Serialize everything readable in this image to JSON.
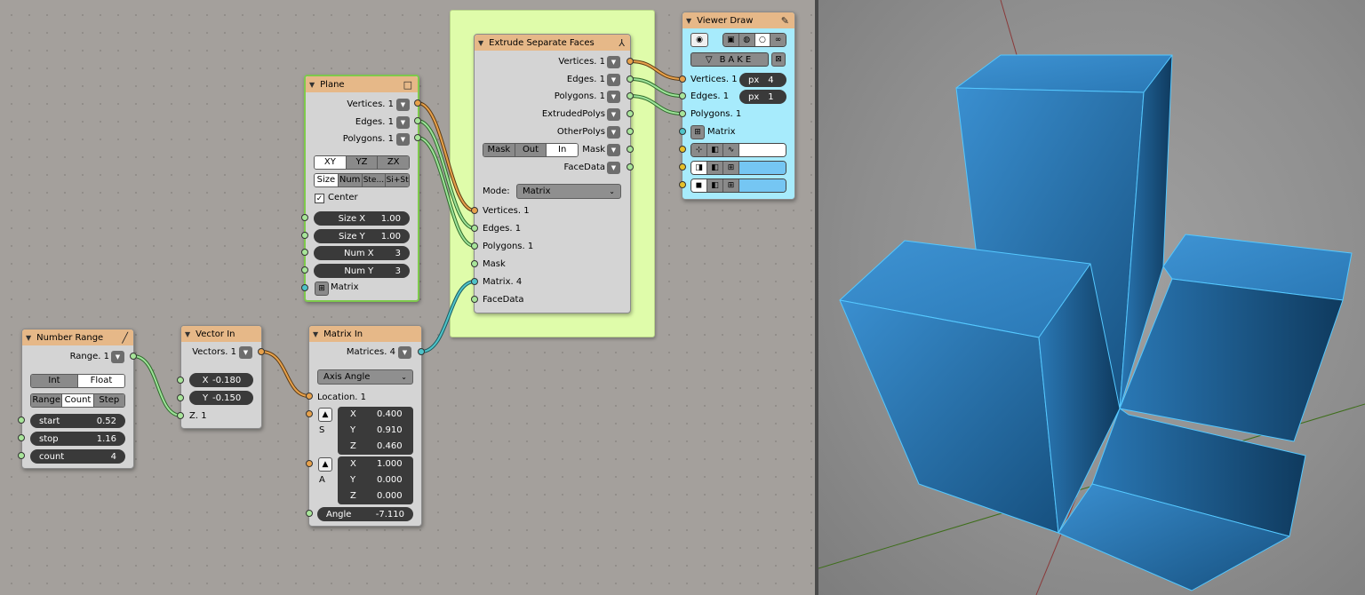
{
  "frame": {
    "color": "#dffcaa"
  },
  "nodes": {
    "number_range": {
      "title": "Number Range",
      "output": "Range. 1",
      "mode_tabs": [
        "Int",
        "Float"
      ],
      "range_tabs": [
        "Range",
        "Count",
        "Step"
      ],
      "fields": [
        {
          "label": "start",
          "value": "0.52"
        },
        {
          "label": "stop",
          "value": "1.16"
        },
        {
          "label": "count",
          "value": "4"
        }
      ]
    },
    "vector_in": {
      "title": "Vector In",
      "output": "Vectors. 1",
      "fields": [
        {
          "label": "X",
          "value": "-0.180"
        },
        {
          "label": "Y",
          "value": "-0.150"
        }
      ],
      "z_input": "Z. 1"
    },
    "matrix_in": {
      "title": "Matrix In",
      "output": "Matrices. 4",
      "mode": "Axis Angle",
      "location": "Location. 1",
      "scale_label": "S",
      "scale": [
        {
          "label": "X",
          "value": "0.400"
        },
        {
          "label": "Y",
          "value": "0.910"
        },
        {
          "label": "Z",
          "value": "0.460"
        }
      ],
      "axis_label": "A",
      "axis": [
        {
          "label": "X",
          "value": "1.000"
        },
        {
          "label": "Y",
          "value": "0.000"
        },
        {
          "label": "Z",
          "value": "0.000"
        }
      ],
      "angle": {
        "label": "Angle",
        "value": "-7.110"
      }
    },
    "plane": {
      "title": "Plane",
      "outputs": [
        "Vertices. 1",
        "Edges. 1",
        "Polygons. 1"
      ],
      "plane_tabs": [
        "XY",
        "YZ",
        "ZX"
      ],
      "dim_tabs": [
        "Size",
        "Num",
        "Ste...",
        "Si+St"
      ],
      "center_label": "Center",
      "fields": [
        {
          "label": "Size X",
          "value": "1.00"
        },
        {
          "label": "Size Y",
          "value": "1.00"
        },
        {
          "label": "Num X",
          "value": "3"
        },
        {
          "label": "Num Y",
          "value": "3"
        }
      ],
      "matrix_label": "Matrix"
    },
    "extrude": {
      "title": "Extrude Separate Faces",
      "outputs": [
        "Vertices. 1",
        "Edges. 1",
        "Polygons. 1",
        "ExtrudedPolys",
        "OtherPolys",
        "Mask",
        "FaceData"
      ],
      "mask_tabs": [
        "Mask",
        "Out",
        "In"
      ],
      "mode_label": "Mode:",
      "mode_value": "Matrix",
      "inputs": [
        "Vertices. 1",
        "Edges. 1",
        "Polygons. 1",
        "Mask",
        "Matrix. 4",
        "FaceData"
      ]
    },
    "viewer_draw": {
      "title": "Viewer Draw",
      "bake_label": "BAKE",
      "inputs": [
        {
          "label": "Vertices. 1",
          "px": "px",
          "value": "4"
        },
        {
          "label": "Edges. 1",
          "px": "px",
          "value": "1"
        },
        {
          "label": "Polygons. 1"
        },
        {
          "label": "Matrix"
        }
      ],
      "colors": [
        "#ffffff",
        "#75c6f3",
        "#75c6f3"
      ]
    }
  },
  "viewport": {
    "mesh_color": "#2e7fbe",
    "edge_color": "#55c8ff"
  }
}
